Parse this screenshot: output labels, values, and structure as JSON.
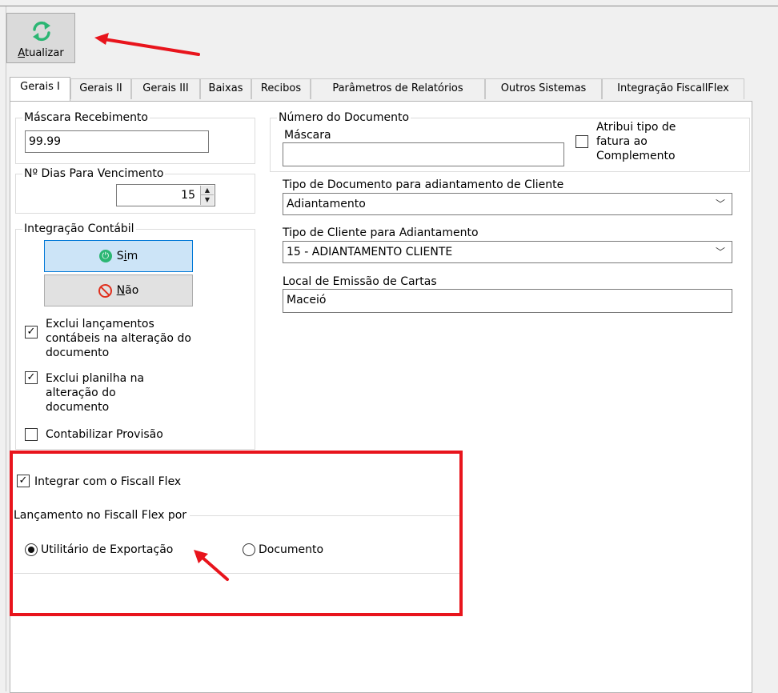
{
  "toolbar": {
    "refresh_label_first": "A",
    "refresh_label_rest": "tualizar"
  },
  "tabs": [
    "Gerais I",
    "Gerais II",
    "Gerais III",
    "Baixas",
    "Recibos",
    "Parâmetros de Relatórios",
    "Outros Sistemas",
    "Integração FiscallFlex"
  ],
  "left": {
    "mascara_recebimento": {
      "label": "Máscara Recebimento",
      "value": "99.99"
    },
    "dias_vencimento": {
      "label": "Nº Dias Para Vencimento",
      "value": "15"
    },
    "integracao_contabil": {
      "label": "Integração Contábil",
      "sim_label_pre": "S",
      "sim_label_ul": "i",
      "sim_label_post": "m",
      "nao_label_ul": "N",
      "nao_label_post": "ão",
      "exclui_lancamentos": [
        "Exclui lançamentos",
        "contábeis na alteração do",
        "documento"
      ],
      "exclui_planilha": [
        "Exclui planilha na",
        "alteração do",
        "documento"
      ],
      "contabilizar_provisao": "Contabilizar Provisão"
    }
  },
  "fiscall": {
    "integrar_label": "Integrar com o Fiscall Flex",
    "lancamento_label": "Lançamento no Fiscall Flex por",
    "opt_utilitario": "Utilitário de Exportação",
    "opt_documento": "Documento"
  },
  "right": {
    "numero_documento": {
      "label": "Número do Documento",
      "mascara_label": "Máscara",
      "mascara_value": "",
      "atribui": [
        "Atribui tipo de",
        "fatura ao",
        "Complemento"
      ]
    },
    "tipo_doc": {
      "label": "Tipo de Documento para adiantamento de Cliente",
      "value": "Adiantamento"
    },
    "tipo_cliente": {
      "label": "Tipo de Cliente para Adiantamento",
      "value": "15 - ADIANTAMENTO CLIENTE"
    },
    "local_emissao": {
      "label": "Local de Emissão de Cartas",
      "value": "Maceió"
    }
  },
  "colors": {
    "highlight": "#e8141c",
    "refresh_icon": "#2bb673",
    "selected_button": "#cce4f7"
  }
}
